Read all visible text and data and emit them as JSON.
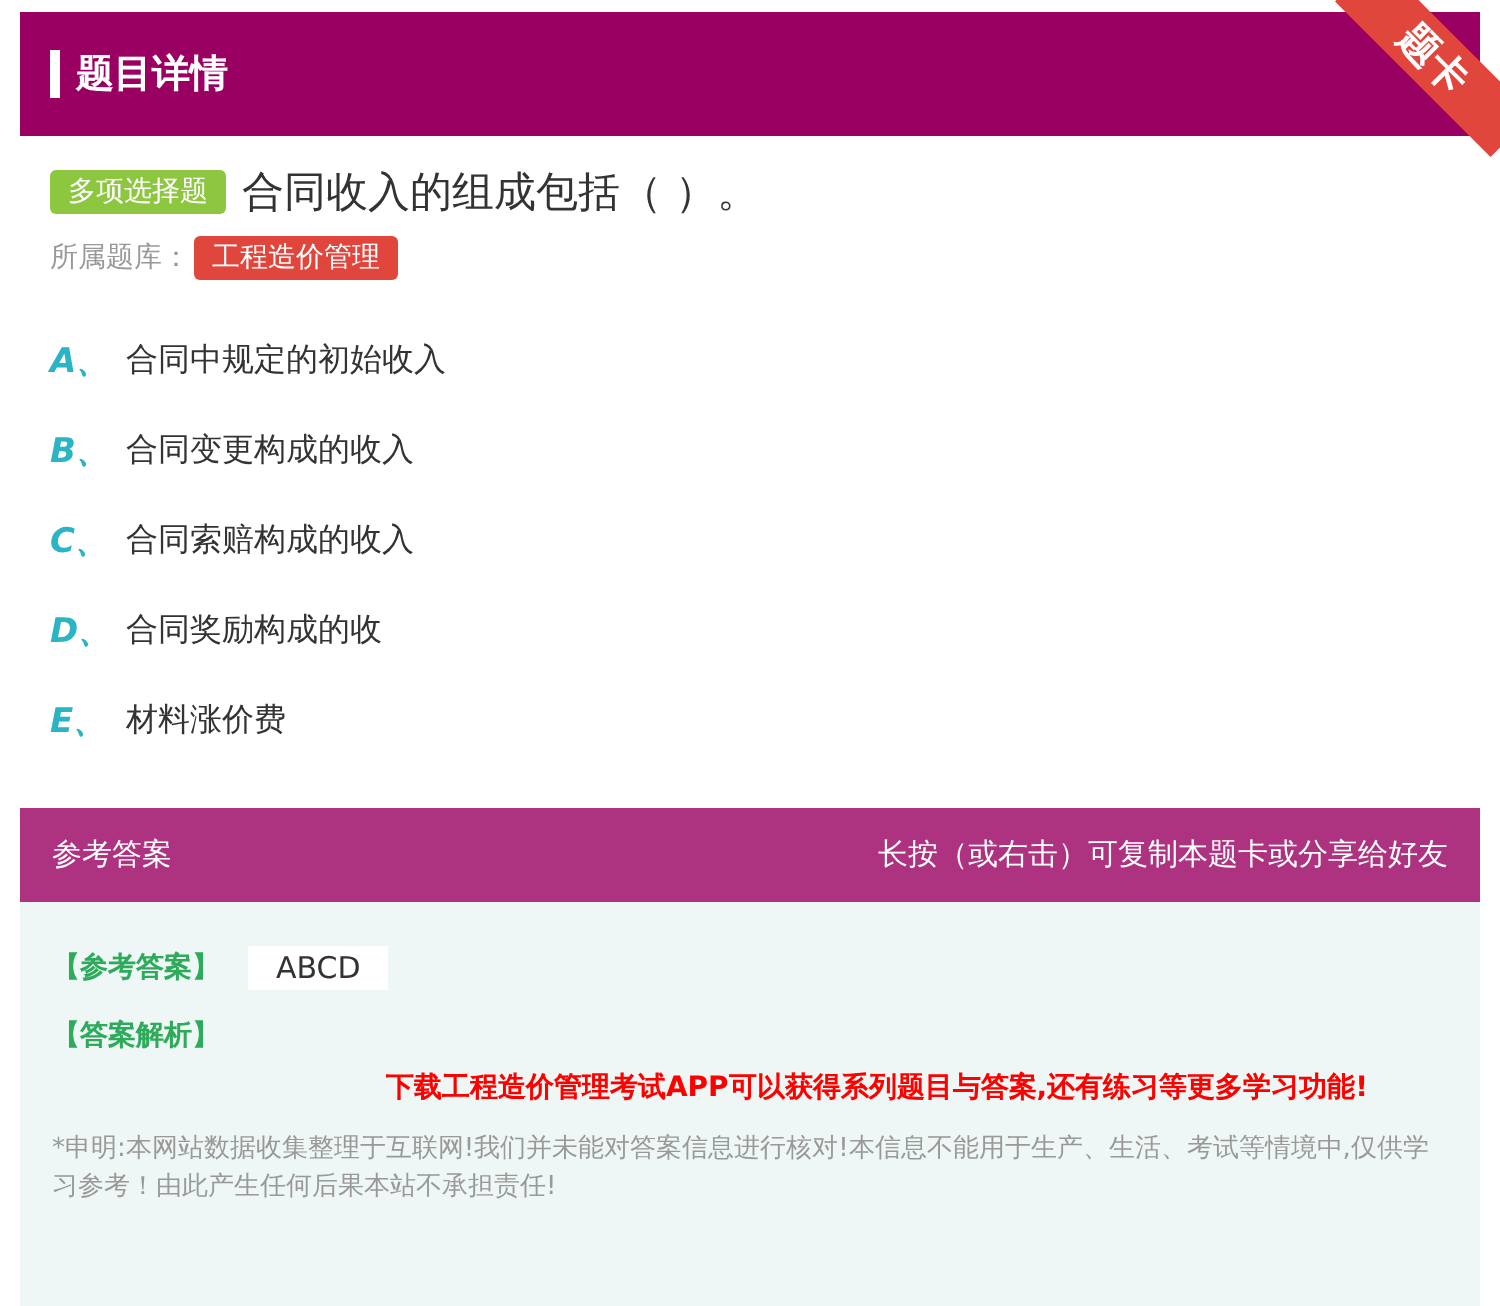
{
  "header": {
    "title": "题目详情",
    "ribbon": "题卡"
  },
  "question": {
    "type_badge": "多项选择题",
    "text": "合同收入的组成包括（ ）。",
    "bank_label": "所属题库：",
    "bank": "工程造价管理"
  },
  "options": [
    {
      "letter": "A、",
      "text": "合同中规定的初始收入"
    },
    {
      "letter": "B、",
      "text": "合同变更构成的收入"
    },
    {
      "letter": "C、",
      "text": "合同索赔构成的收入"
    },
    {
      "letter": "D、",
      "text": "合同奖励构成的收"
    },
    {
      "letter": "E、",
      "text": "材料涨价费"
    }
  ],
  "answer": {
    "title": "参考答案",
    "hint": "长按（或右击）可复制本题卡或分享给好友",
    "answer_label": "【参考答案】",
    "answer_value": "ABCD",
    "analysis_label": "【答案解析】",
    "promo": "下载工程造价管理考试APP可以获得系列题目与答案,还有练习等更多学习功能!",
    "disclaimer": "*申明:本网站数据收集整理于互联网!我们并未能对答案信息进行核对!本信息不能用于生产、生活、考试等情境中,仅供学习参考！由此产生任何后果本站不承担责任!"
  }
}
